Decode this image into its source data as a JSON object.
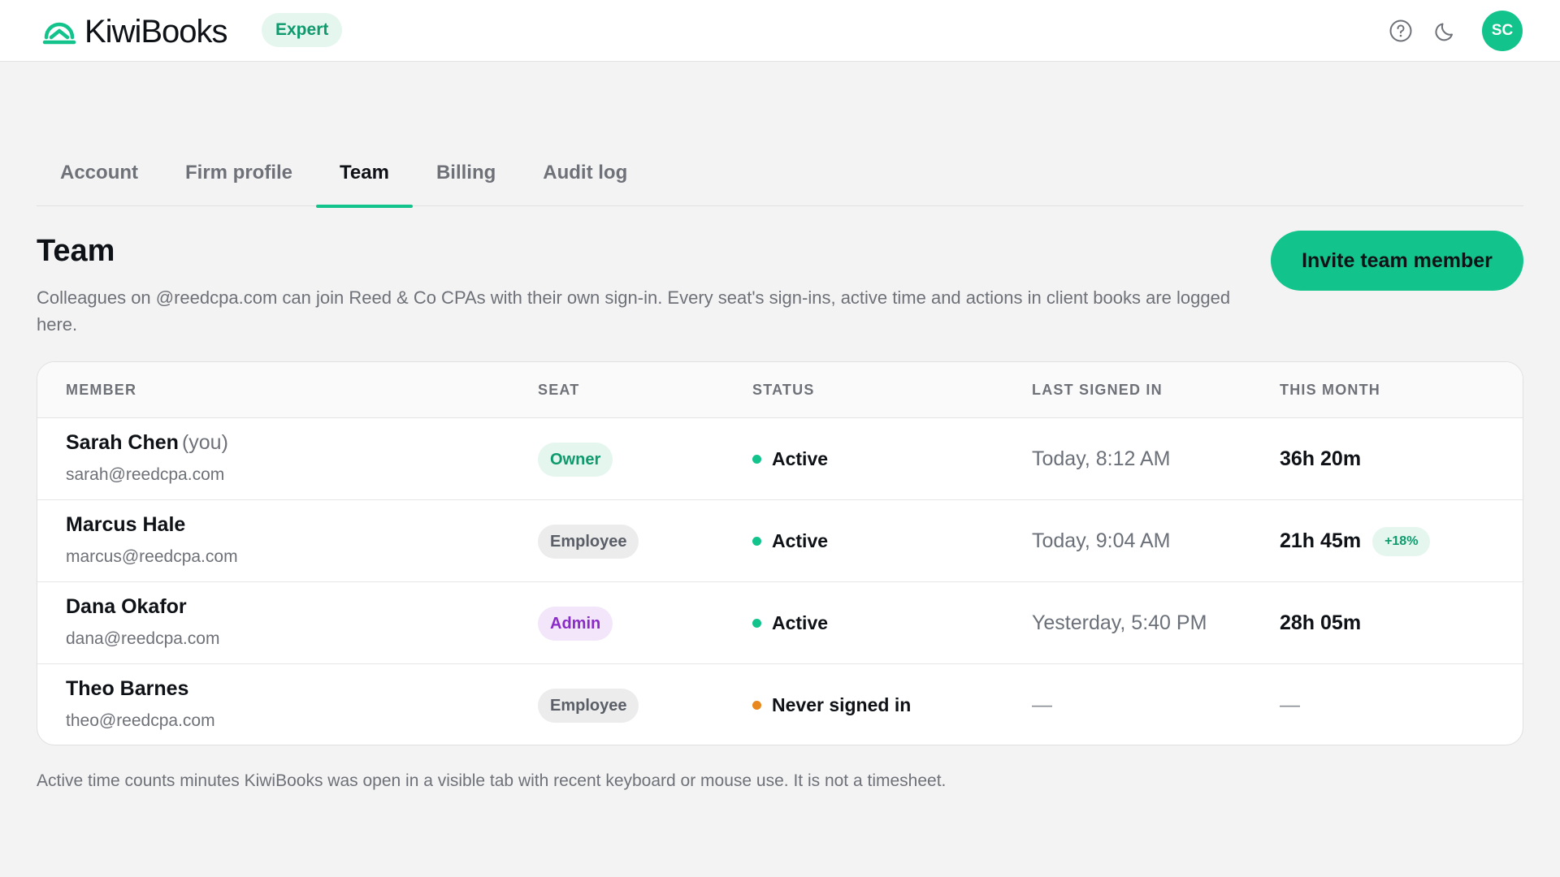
{
  "header": {
    "brand": "KiwiBooks",
    "plan_badge": "Expert",
    "help_icon": "help-circle-icon",
    "theme_icon": "moon-icon",
    "avatar_initials": "SC"
  },
  "tabs": [
    {
      "label": "Account",
      "active": false
    },
    {
      "label": "Firm profile",
      "active": false
    },
    {
      "label": "Team",
      "active": true
    },
    {
      "label": "Billing",
      "active": false
    },
    {
      "label": "Audit log",
      "active": false
    }
  ],
  "section": {
    "title": "Team",
    "description": "Colleagues on @reedcpa.com can join Reed & Co CPAs with their own sign-in. Every seat's sign-ins, active time and actions in client books are logged here.",
    "invite_label": "Invite team member"
  },
  "table": {
    "columns": {
      "member": "MEMBER",
      "seat": "SEAT",
      "status": "STATUS",
      "last_signed_in": "LAST SIGNED IN",
      "this_month": "THIS MONTH"
    },
    "rows": [
      {
        "name": "Sarah Chen",
        "you": "(you)",
        "email": "sarah@reedcpa.com",
        "seat": "Owner",
        "status": "Active",
        "last_signed_in": "Today, 8:12 AM",
        "this_month": "36h 20m",
        "delta": ""
      },
      {
        "name": "Marcus Hale",
        "you": "",
        "email": "marcus@reedcpa.com",
        "seat": "Employee",
        "status": "Active",
        "last_signed_in": "Today, 9:04 AM",
        "this_month": "21h 45m",
        "delta": "+18%"
      },
      {
        "name": "Dana Okafor",
        "you": "",
        "email": "dana@reedcpa.com",
        "seat": "Admin",
        "status": "Active",
        "last_signed_in": "Yesterday, 5:40 PM",
        "this_month": "28h 05m",
        "delta": ""
      },
      {
        "name": "Theo Barnes",
        "you": "",
        "email": "theo@reedcpa.com",
        "seat": "Employee",
        "status": "Never signed in",
        "last_signed_in": "—",
        "this_month": "—",
        "delta": ""
      }
    ]
  },
  "footnote": "Active time counts minutes KiwiBooks was open in a visible tab with recent keyboard or mouse use. It is not a timesheet.",
  "colors": {
    "accent": "#12c48b",
    "status_active": "#12c48b",
    "status_never": "#e8871e",
    "admin_badge": "#8a2bc8"
  }
}
